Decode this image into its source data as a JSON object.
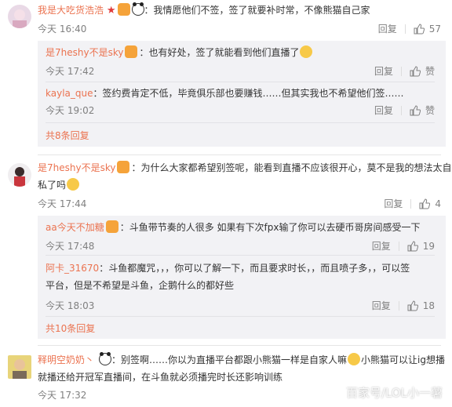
{
  "comments": [
    {
      "user": "我是大吃货浩浩",
      "text": "：我情愿他们不签，签了就要补时常，不像熊猫自己家",
      "time": "今天 16:40",
      "reply_label": "回复",
      "likes": "57",
      "replies": [
        {
          "user": "是7heshy不是sky",
          "text": "：也有好处，签了就能看到他们直播了",
          "time": "今天 17:42",
          "reply_label": "回复",
          "like_label": "赞"
        },
        {
          "user": "kayla_que",
          "text": "：签约费肯定不低，毕竟俱乐部也要赚钱……但其实我也不希望他们签……",
          "time": "今天 19:02",
          "reply_label": "回复",
          "like_label": "赞"
        }
      ],
      "more": "共8条回复"
    },
    {
      "user": "是7heshy不是sky",
      "text_line1": "：为什么大家都希望别签呢，能看到直播不应该很开心，莫不是我的想法太自",
      "text_line2": "私了吗",
      "time": "今天 17:44",
      "reply_label": "回复",
      "likes": "4",
      "replies": [
        {
          "user": "aa今天不加糖",
          "text": "：斗鱼带节奏的人很多 如果有下次fpx输了你可以去硬币哥房间感受一下",
          "time": "今天 17:48",
          "reply_label": "回复",
          "likes": "19"
        },
        {
          "user": "阿卡_31670",
          "text_line1": "：斗鱼都魔咒，，，你可以了解一下，而且要求时长，，而且喷子多，，可以签",
          "text_line2": "平台，但是不希望是斗鱼，企鹅什么的都好些",
          "time": "今天 18:03",
          "reply_label": "回复",
          "likes": "18"
        }
      ],
      "more": "共10条回复"
    },
    {
      "user": "释明空奶奶丶",
      "text_line1": "：别签啊……你以为直播平台都跟小熊猫一样是自家人嘛",
      "text_line1b": "小熊猫可以让ig想播",
      "text_line2": "就播还给开冠军直播间，在斗鱼就必须播完时长还影响训练",
      "time": "今天 17:32"
    }
  ],
  "watermark": "百家号/LOL小一薯",
  "colors": {
    "username": "#eb7350",
    "meta": "#808080",
    "reply_bg": "#f2f2f5"
  }
}
